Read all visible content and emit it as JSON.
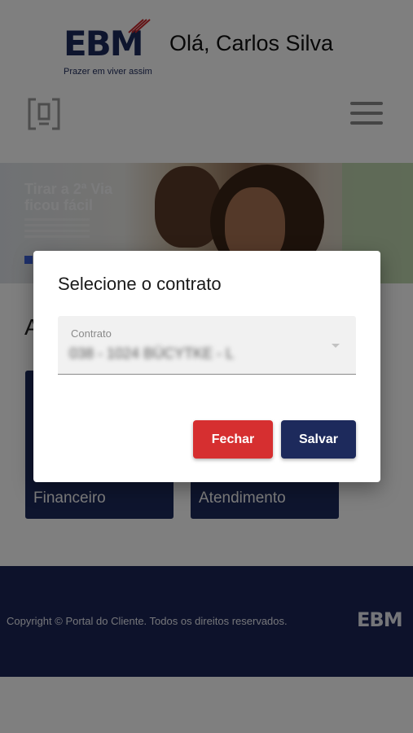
{
  "header": {
    "brand": "EBM",
    "tagline": "Prazer em viver assim",
    "greeting": "Olá, Carlos Silva",
    "left_icon": "contract-icon",
    "menu_icon": "hamburger-menu-icon"
  },
  "banner": {
    "title": "Tirar a 2ª Via ficou fácil"
  },
  "main": {
    "section_initial": "A",
    "cards": [
      {
        "label": "Financeiro"
      },
      {
        "label": "Atendimento"
      }
    ]
  },
  "footer": {
    "copyright": "Copyright © Portal do Cliente. Todos os direitos reservados.",
    "brand": "EBM"
  },
  "modal": {
    "title": "Selecione o contrato",
    "select_label": "Contrato",
    "select_value": "038 - 1024 BÜCYTKE - L",
    "close_label": "Fechar",
    "save_label": "Salvar"
  },
  "colors": {
    "brand_navy": "#1d2a5c",
    "close_red": "#d62f30",
    "footer_bg": "#1b2457"
  }
}
